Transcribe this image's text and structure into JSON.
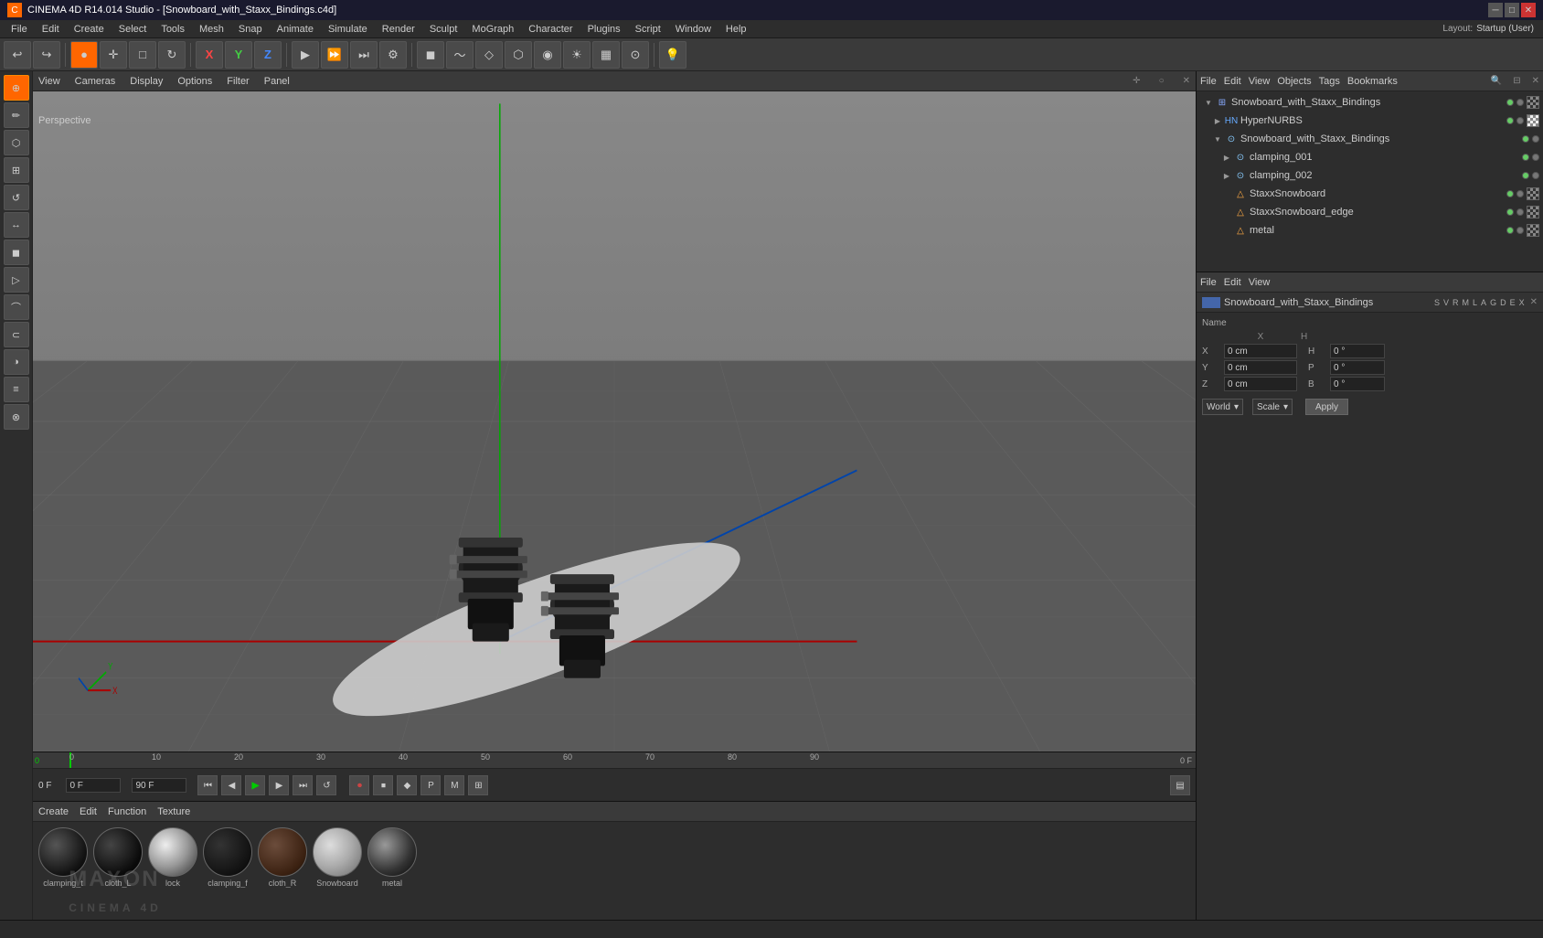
{
  "titleBar": {
    "title": "CINEMA 4D R14.014 Studio - [Snowboard_with_Staxx_Bindings.c4d]",
    "winButtons": [
      "─",
      "□",
      "✕"
    ]
  },
  "menuBar": {
    "items": [
      "File",
      "Edit",
      "Create",
      "Select",
      "Tools",
      "Mesh",
      "Snap",
      "Animate",
      "Simulate",
      "Render",
      "Sculpt",
      "MoGraph",
      "Character",
      "Plugins",
      "Script",
      "Window",
      "Help"
    ]
  },
  "layout": {
    "label": "Layout:",
    "value": "Startup (User)"
  },
  "viewport": {
    "menus": [
      "View",
      "Cameras",
      "Display",
      "Options",
      "Filter",
      "Panel"
    ],
    "perspective": "Perspective"
  },
  "objectManager": {
    "menus": [
      "File",
      "Edit",
      "View",
      "Objects",
      "Tags",
      "Bookmarks"
    ],
    "objects": [
      {
        "name": "Snowboard_with_Staxx_Bindings",
        "level": 0,
        "type": "scene",
        "expanded": true
      },
      {
        "name": "HyperNURBS",
        "level": 1,
        "type": "hypernurbs",
        "expanded": false
      },
      {
        "name": "Snowboard_with_Staxx_Bindings",
        "level": 1,
        "type": "null",
        "expanded": true
      },
      {
        "name": "clamping_001",
        "level": 2,
        "type": "null",
        "expanded": false
      },
      {
        "name": "clamping_002",
        "level": 2,
        "type": "null",
        "expanded": false
      },
      {
        "name": "StaxxSnowboard",
        "level": 2,
        "type": "poly",
        "expanded": false
      },
      {
        "name": "StaxxSnowboard_edge",
        "level": 2,
        "type": "poly",
        "expanded": false
      },
      {
        "name": "metal",
        "level": 2,
        "type": "poly",
        "expanded": false
      }
    ]
  },
  "attributeManager": {
    "menus": [
      "File",
      "Edit",
      "View"
    ],
    "selectedObject": "Snowboard_with_Staxx_Bindings",
    "columns": [
      "S",
      "V",
      "R",
      "M",
      "L",
      "A",
      "G",
      "D",
      "E",
      "X"
    ],
    "coords": {
      "x": {
        "label": "X",
        "pos": "0 cm",
        "h": "0°"
      },
      "y": {
        "label": "Y",
        "pos": "0 cm",
        "p": "0°"
      },
      "z": {
        "label": "Z",
        "pos": "0 cm",
        "b": "0°"
      }
    },
    "worldDropdown": "World",
    "scaleDropdown": "Scale",
    "applyButton": "Apply"
  },
  "materialPanel": {
    "menus": [
      "Create",
      "Edit",
      "Function",
      "Texture"
    ],
    "materials": [
      {
        "name": "clamping_t",
        "class": "mat-black"
      },
      {
        "name": "cloth_L",
        "class": "mat-dark"
      },
      {
        "name": "lock",
        "class": "mat-chrome"
      },
      {
        "name": "clamping_f",
        "class": "mat-dark2"
      },
      {
        "name": "cloth_R",
        "class": "mat-brown"
      },
      {
        "name": "Snowboard",
        "class": "mat-silver"
      },
      {
        "name": "metal",
        "class": "mat-glossy"
      }
    ]
  },
  "timeline": {
    "currentFrame": "0 F",
    "totalFrames": "90 F",
    "startFrame": "0 F",
    "endFrame": "90 F",
    "ticks": [
      0,
      10,
      20,
      30,
      40,
      50,
      60,
      70,
      80,
      90
    ]
  },
  "statusBar": {
    "text": ""
  }
}
